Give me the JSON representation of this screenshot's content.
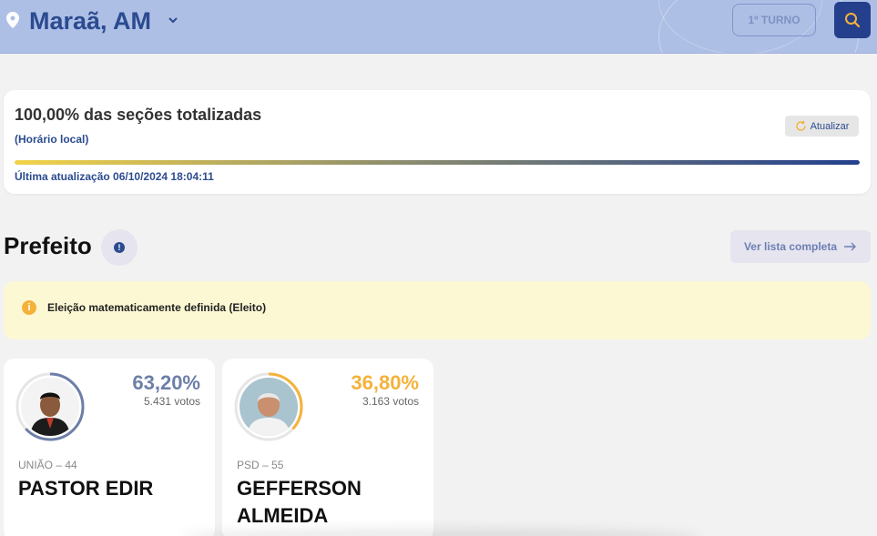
{
  "header": {
    "location": "Maraã, AM",
    "turno_label": "1º TURNO"
  },
  "status": {
    "title": "100,00% das seções totalizadas",
    "subtitle": "(Horário local)",
    "refresh_label": "Atualizar",
    "progress_fraction": 1.0,
    "last_update": "Última atualização 06/10/2024 18:04:11"
  },
  "section": {
    "title": "Prefeito",
    "full_list_label": "Ver lista completa"
  },
  "notice": {
    "text": "Eleição matematicamente definida (Eleito)"
  },
  "candidates": [
    {
      "percent": "63,20%",
      "percent_value": 63.2,
      "votes": "5.431 votos",
      "party": "UNIÃO – 44",
      "name": "PASTOR EDIR",
      "color": "#6d7fa8"
    },
    {
      "percent": "36,80%",
      "percent_value": 36.8,
      "votes": "3.163 votos",
      "party": "PSD – 55",
      "name": "GEFFERSON ALMEIDA",
      "color": "#f4b23a"
    }
  ],
  "colors": {
    "brand_blue": "#2b4b8f",
    "header_bg": "#aebfe6",
    "accent_orange": "#f4b23a"
  }
}
